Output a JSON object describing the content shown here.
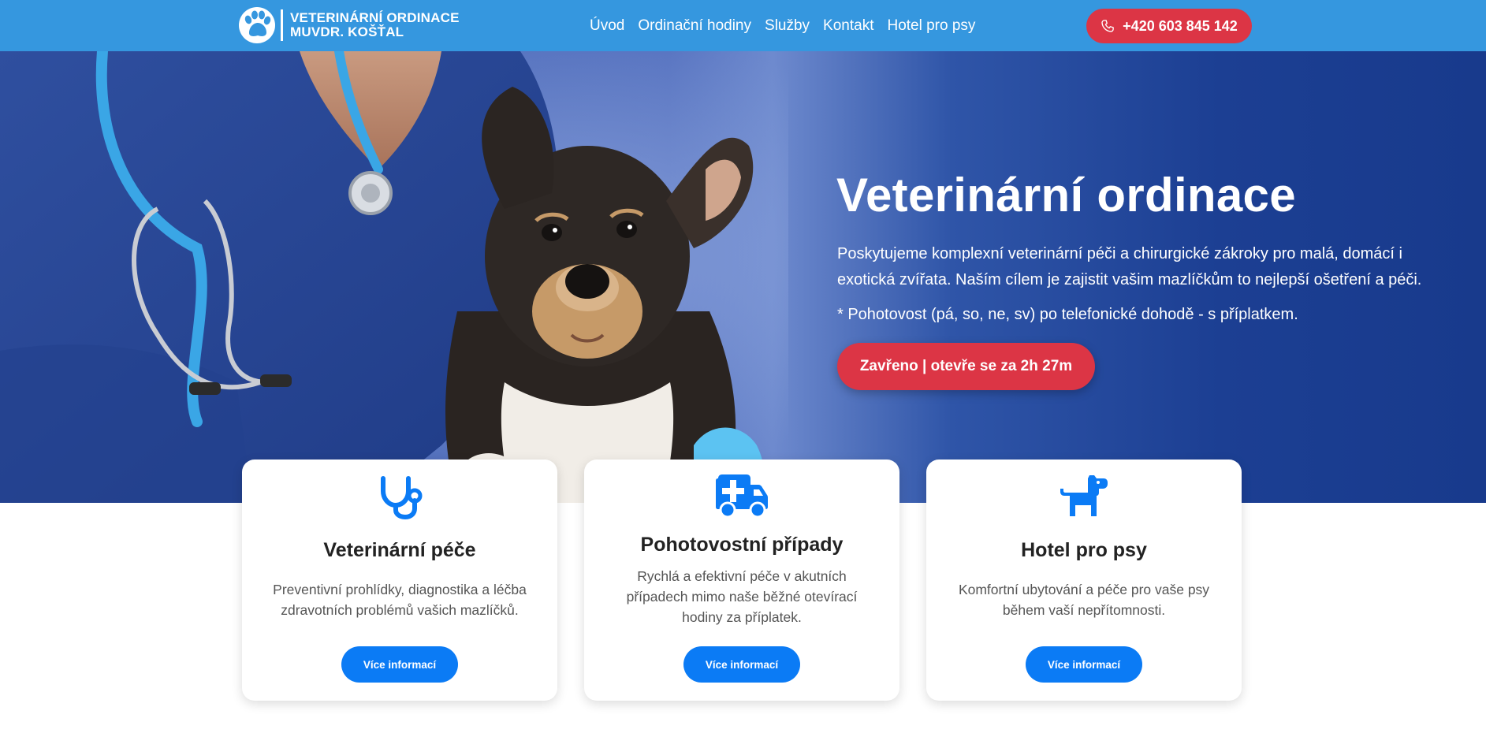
{
  "brand": {
    "line1": "VETERINÁRNÍ ORDINACE",
    "line2": "MUVDR. KOŠŤAL",
    "logo_icon": "paw-icon"
  },
  "nav": {
    "items": [
      {
        "label": "Úvod"
      },
      {
        "label": "Ordinační hodiny"
      },
      {
        "label": "Služby"
      },
      {
        "label": "Kontakt"
      },
      {
        "label": "Hotel pro psy"
      }
    ],
    "phone": "+420 603 845 142",
    "phone_icon": "phone-icon"
  },
  "hero": {
    "title": "Veterinární ordinace",
    "description": "Poskytujeme komplexní veterinární péči a chirurgické zákroky pro malá, domácí i exotická zvířata. Naším cílem je zajistit vašim mazlíčkům to nejlepší ošetření a péči.",
    "note": "* Pohotovost (pá, so, ne, sv) po telefonické dohodě - s příplatkem.",
    "status_button": "Zavřeno | otevře se za 2h 27m"
  },
  "cards": [
    {
      "icon": "stethoscope-icon",
      "title": "Veterinární péče",
      "text": "Preventivní prohlídky, diagnostika a léčba zdravotních problémů vašich mazlíčků.",
      "button": "Více informací"
    },
    {
      "icon": "ambulance-icon",
      "title": "Pohotovostní případy",
      "text": "Rychlá a efektivní péče v akutních případech mimo naše běžné otevírací hodiny za příplatek.",
      "button": "Více informací"
    },
    {
      "icon": "dog-icon",
      "title": "Hotel pro psy",
      "text": "Komfortní ubytování a péče pro vaše psy během vaší nepřítomnosti.",
      "button": "Více informací"
    }
  ],
  "colors": {
    "navbar": "#3597df",
    "hero_dark": "#183a8c",
    "accent_red": "#dc3545",
    "accent_blue": "#0b7bf5"
  }
}
